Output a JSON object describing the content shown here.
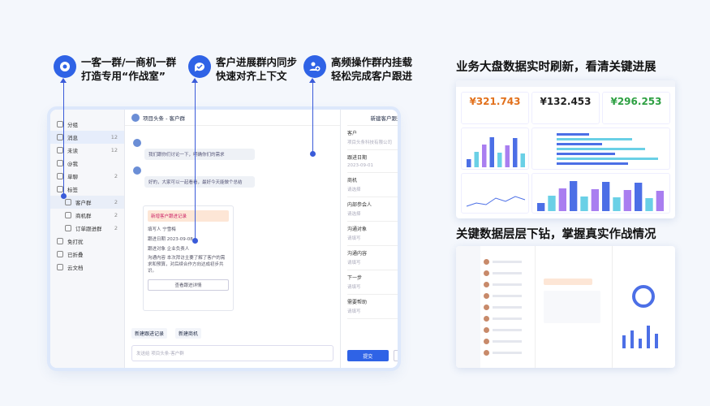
{
  "features": [
    {
      "icon": "group-chat-icon",
      "line1": "一客一群/一商机一群",
      "line2": "打造专用“作战室”"
    },
    {
      "icon": "sync-chat-icon",
      "line1": "客户进展群内同步",
      "line2": "快速对齐上下文"
    },
    {
      "icon": "users-icon",
      "line1": "高频操作群内挂载",
      "line2": "轻松完成客户跟进"
    }
  ],
  "sidebar": {
    "items": [
      {
        "label": "分组",
        "count": ""
      },
      {
        "label": "消息",
        "count": "12"
      },
      {
        "label": "未读",
        "count": "12"
      },
      {
        "label": "@我",
        "count": ""
      },
      {
        "label": "单聊",
        "count": "2"
      },
      {
        "label": "标签",
        "count": ""
      }
    ],
    "subitems": [
      {
        "label": "客户群",
        "count": "2"
      },
      {
        "label": "商机群",
        "count": "2"
      },
      {
        "label": "订单跟进群",
        "count": "2"
      }
    ],
    "bottom": [
      "免打扰",
      "已折叠",
      "云文档"
    ]
  },
  "chat": {
    "title": "项目头条 - 客户群",
    "msg1": "我们跟你们讨论一下，明确你们的需求",
    "msg2": "好的，大家可以一起看看，最好今天能做个总结",
    "card_tag": "新增客户跟进记录",
    "card_lines": [
      "填写人  宁雪梅",
      "跟进日期  2023-09-08",
      "跟进对象  企业负责人",
      "沟通内容  本次拜访主要了解了客户的需求和预算，对后续合作方向达成初步共识。"
    ],
    "card_button": "查看跟进详情",
    "tool1": "新建跟进记录",
    "tool2": "新建商机",
    "input_placeholder": "发送给 项目头条-客户群"
  },
  "form": {
    "title": "新建客户跟进记录",
    "fields": [
      {
        "label": "客户",
        "value": "项目头条科技有限公司"
      },
      {
        "label": "跟进日期",
        "value": "2023-09-01"
      },
      {
        "label": "商机",
        "value": "请选择"
      },
      {
        "label": "内部参会人",
        "value": "请选择"
      },
      {
        "label": "沟通对象",
        "value": "请填写"
      },
      {
        "label": "沟通内容",
        "value": "请填写"
      },
      {
        "label": "下一步",
        "value": "请填写"
      },
      {
        "label": "需要帮助",
        "value": "请填写"
      }
    ],
    "submit": "提交",
    "cancel": "取消"
  },
  "right": {
    "headline1": "业务大盘数据实时刷新，看清关键进展",
    "headline2": "关键数据层层下钻，掌握真实作战情况",
    "kpis": [
      {
        "value": "¥321.743",
        "color": "#e2711d"
      },
      {
        "value": "¥132.453",
        "color": "#222222"
      },
      {
        "value": "¥296.253",
        "color": "#2ea043"
      }
    ]
  }
}
